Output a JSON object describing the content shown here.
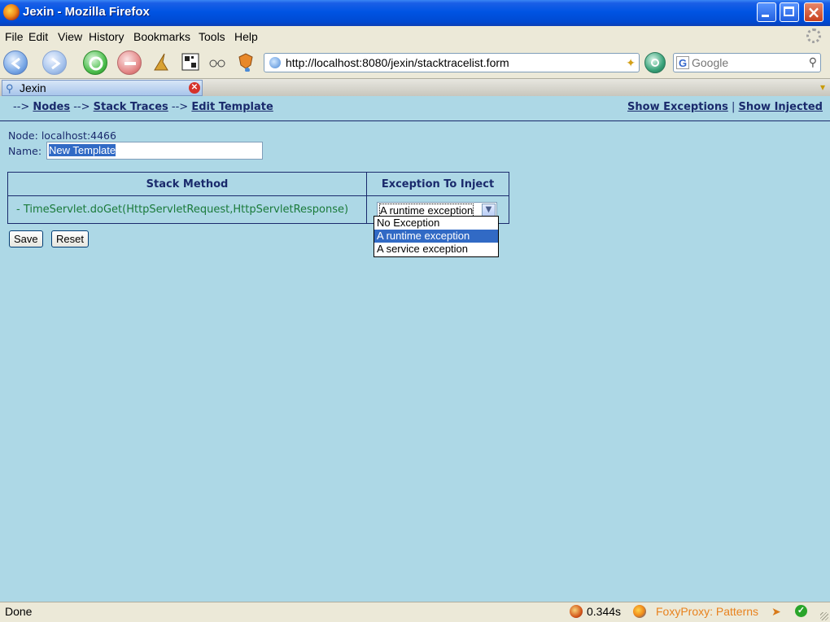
{
  "window": {
    "title": "Jexin - Mozilla Firefox"
  },
  "menu": [
    "File",
    "Edit",
    "View",
    "History",
    "Bookmarks",
    "Tools",
    "Help"
  ],
  "navbar": {
    "url": "http://localhost:8080/jexin/stacktracelist.form",
    "search_placeholder": "Google"
  },
  "tab": {
    "label": "Jexin"
  },
  "breadcrumb": {
    "prefix": "-->",
    "items": [
      "Nodes",
      "Stack Traces",
      "Edit Template"
    ]
  },
  "toplinks": {
    "show_exceptions": "Show Exceptions",
    "separator": "|",
    "show_injected": "Show Injected"
  },
  "form": {
    "node_label": "Node:",
    "node_value": "localhost:4466",
    "name_label": "Name:",
    "name_value": "New Template"
  },
  "table": {
    "headers": [
      "Stack Method",
      "Exception To Inject"
    ],
    "rows": [
      {
        "method": "- TimeServlet.doGet(HttpServletRequest,HttpServletResponse)",
        "exception": "A runtime exception"
      }
    ]
  },
  "dropdown": {
    "options": [
      "No Exception",
      "A runtime exception",
      "A service exception"
    ],
    "selected": "A runtime exception"
  },
  "buttons": {
    "save": "Save",
    "reset": "Reset"
  },
  "status": {
    "text": "Done",
    "timer": "0.344s",
    "foxyproxy": "FoxyProxy: Patterns"
  }
}
